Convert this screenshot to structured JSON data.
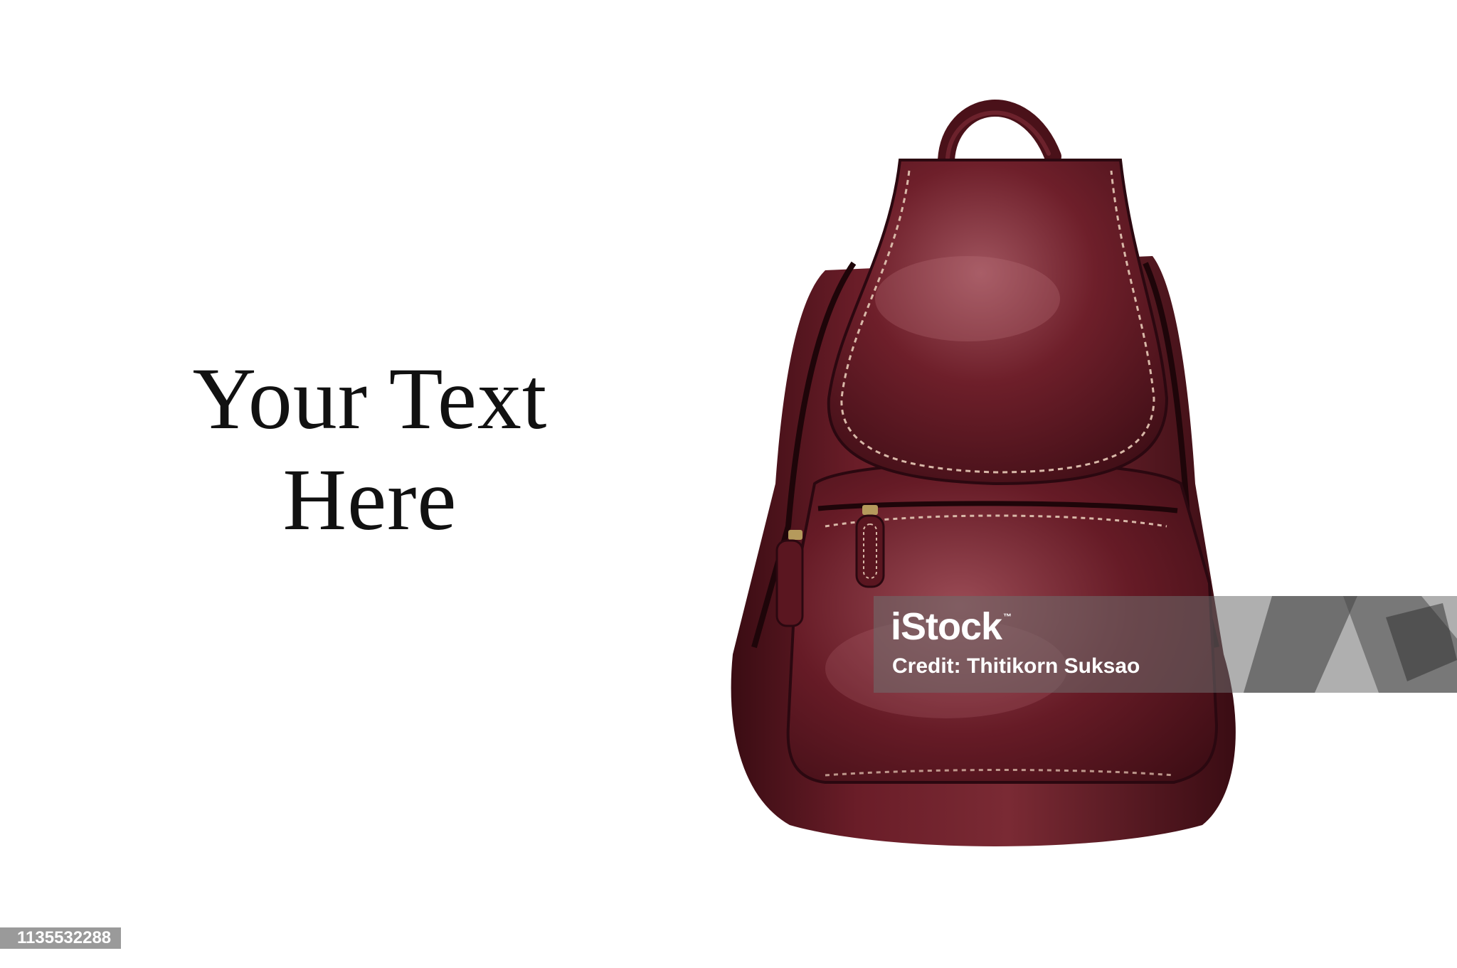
{
  "headline": {
    "line1": "Your Text",
    "line2": "Here"
  },
  "photo": {
    "subject": "backpack",
    "colors": {
      "leather": "#5e1620",
      "highlight": "#a0545e",
      "stitching": "#d8b8a8",
      "zipper": "#b59a5c"
    }
  },
  "watermark": {
    "brand": "iStock",
    "trademark": "™",
    "credit": "Credit: Thitikorn Suksao"
  },
  "image_id": "1135532288"
}
